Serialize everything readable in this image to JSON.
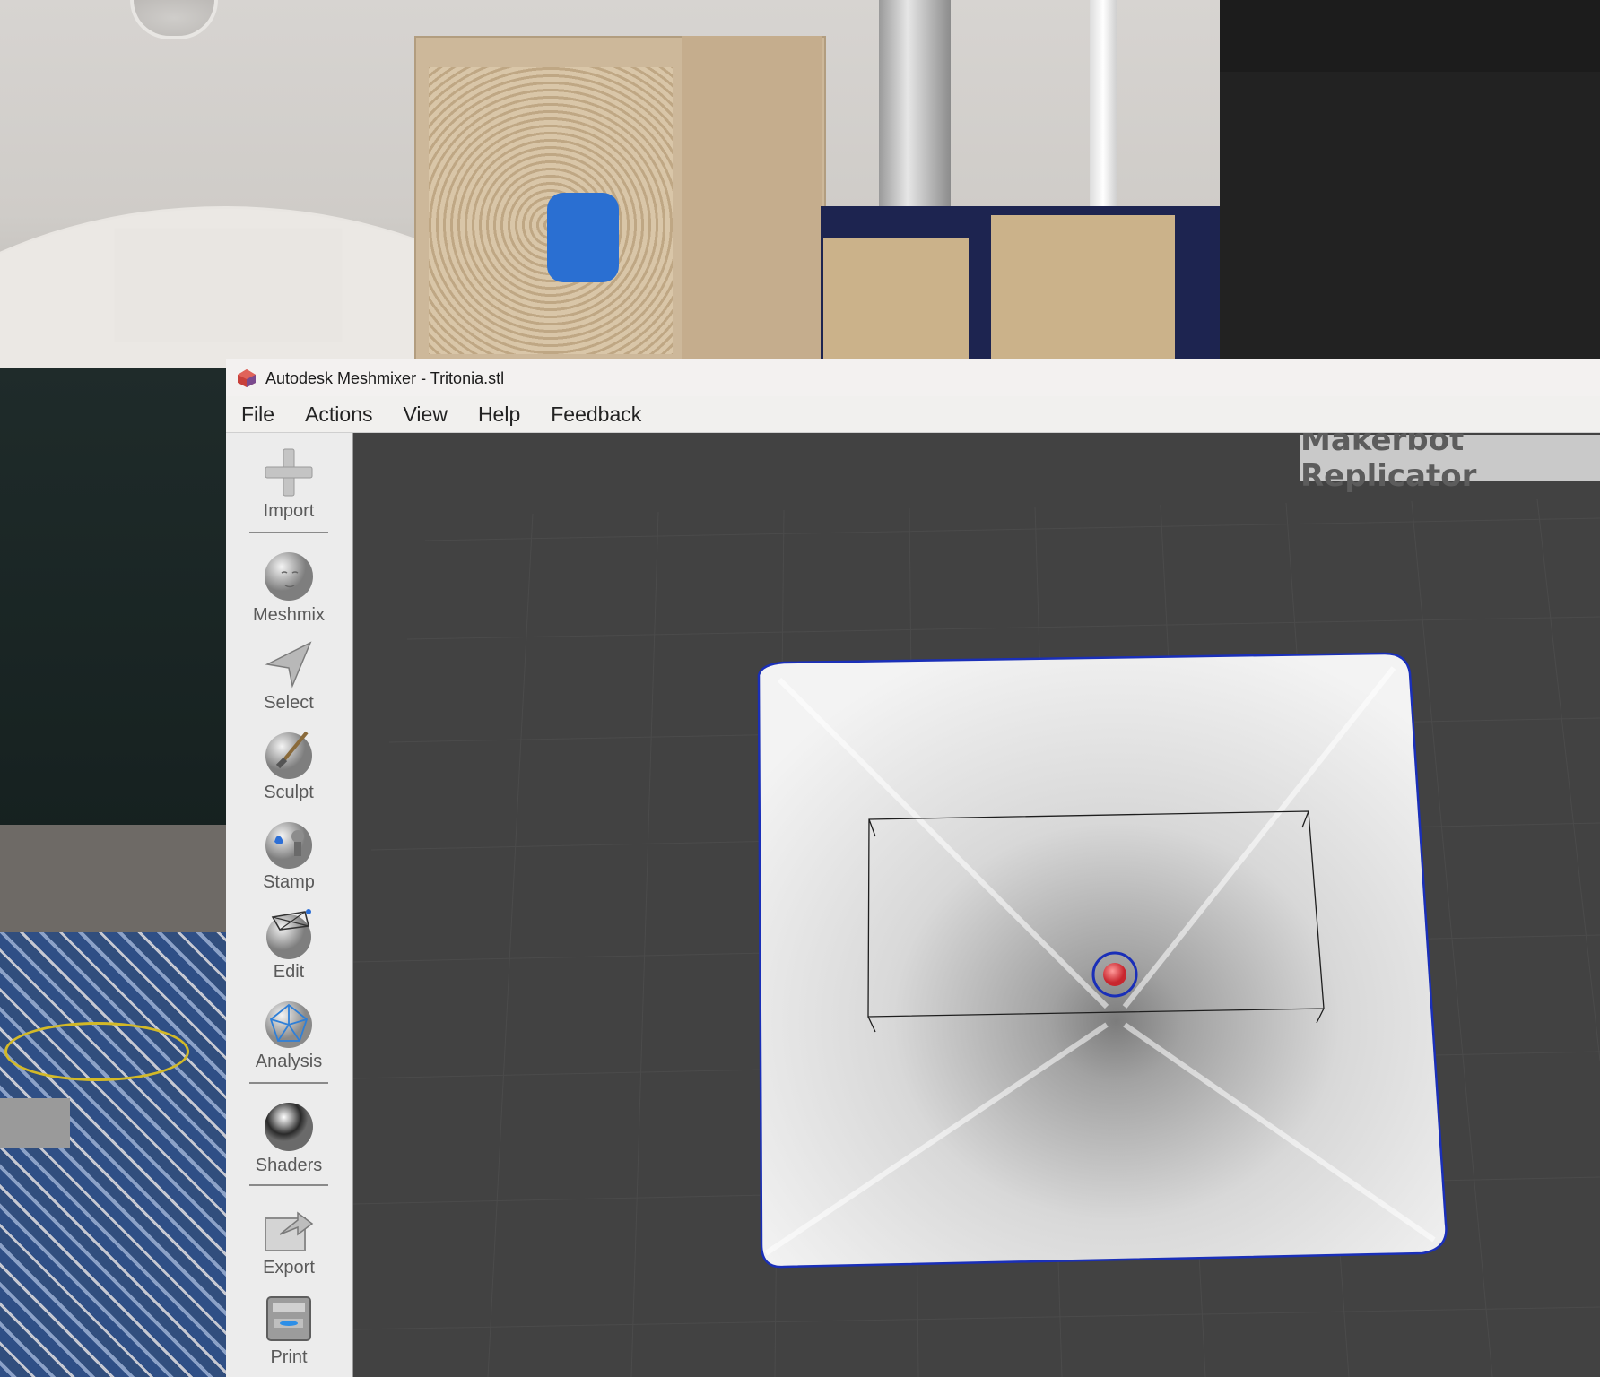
{
  "window": {
    "title": "Autodesk Meshmixer - Tritonia.stl"
  },
  "menu": {
    "items": [
      "File",
      "Actions",
      "View",
      "Help",
      "Feedback"
    ]
  },
  "sidebar": {
    "tools": [
      {
        "label": "Import",
        "icon": "plus-icon"
      },
      {
        "label": "Meshmix",
        "icon": "face-sphere-icon"
      },
      {
        "label": "Select",
        "icon": "arrow-cursor-icon"
      },
      {
        "label": "Sculpt",
        "icon": "brush-sphere-icon"
      },
      {
        "label": "Stamp",
        "icon": "stamp-sphere-icon"
      },
      {
        "label": "Edit",
        "icon": "wireframe-sphere-icon"
      },
      {
        "label": "Analysis",
        "icon": "mesh-sphere-icon"
      },
      {
        "label": "Shaders",
        "icon": "chrome-sphere-icon"
      },
      {
        "label": "Export",
        "icon": "export-folder-icon"
      },
      {
        "label": "Print",
        "icon": "printer-icon"
      }
    ]
  },
  "viewport": {
    "printer_name": "Makerbot Replicator"
  },
  "colors": {
    "viewport_bg": "#424242",
    "model_outline": "#1a2fb8",
    "pivot": "#e8454b"
  }
}
